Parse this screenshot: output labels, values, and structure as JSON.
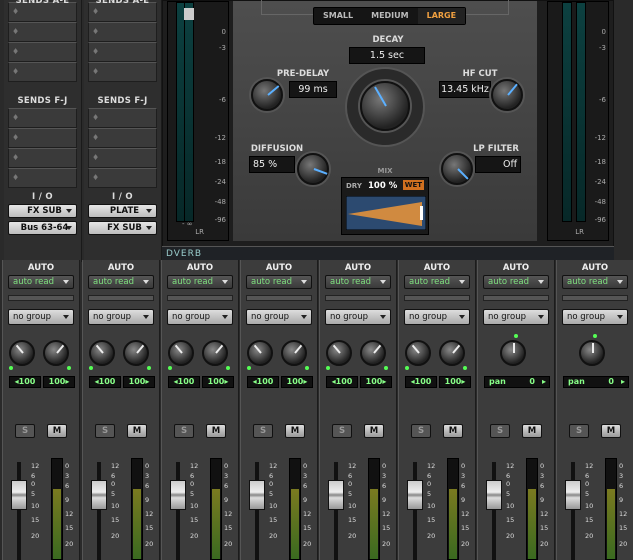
{
  "left_columns": [
    {
      "sends_ae": "SENDS A-E",
      "sends_fj": "SENDS F-J",
      "io": "I / O",
      "in": "FX SUB",
      "out": "Bus 63-64"
    },
    {
      "sends_ae": "SENDS A-E",
      "sends_fj": "SENDS F-J",
      "io": "I / O",
      "in": "PLATE",
      "out": "FX SUB"
    }
  ],
  "plugin": {
    "name": "DVERB",
    "sizes": [
      "SMALL",
      "MEDIUM",
      "LARGE"
    ],
    "decay": {
      "label": "DECAY",
      "value": "1.5 sec"
    },
    "predelay": {
      "label": "PRE-DELAY",
      "value": "99 ms"
    },
    "hfcut": {
      "label": "HF CUT",
      "value": "13.45 kHz"
    },
    "diffusion": {
      "label": "DIFFUSION",
      "value": "85 %"
    },
    "lpfilter": {
      "label": "LP FILTER",
      "value": "Off"
    },
    "mix": {
      "label": "MIX",
      "dry": "DRY",
      "value": "100 %",
      "wet": "WET"
    },
    "meter_scale": [
      "0",
      "-3",
      "-6",
      "-12",
      "-18",
      "-24",
      "-48",
      "-96"
    ],
    "meter_lr": "LR",
    "meter_inf": "- ∞"
  },
  "strips": [
    {
      "auto": "AUTO",
      "mode": "auto read",
      "group": "no group",
      "pan": [
        "100",
        "100"
      ],
      "stereo": true
    },
    {
      "auto": "AUTO",
      "mode": "auto read",
      "group": "no group",
      "pan": [
        "100",
        "100"
      ],
      "stereo": true
    },
    {
      "auto": "AUTO",
      "mode": "auto read",
      "group": "no group",
      "pan": [
        "100",
        "100"
      ],
      "stereo": true
    },
    {
      "auto": "AUTO",
      "mode": "auto read",
      "group": "no group",
      "pan": [
        "100",
        "100"
      ],
      "stereo": true
    },
    {
      "auto": "AUTO",
      "mode": "auto read",
      "group": "no group",
      "pan": [
        "100",
        "100"
      ],
      "stereo": true
    },
    {
      "auto": "AUTO",
      "mode": "auto read",
      "group": "no group",
      "pan": [
        "100",
        "100"
      ],
      "stereo": true
    },
    {
      "auto": "AUTO",
      "mode": "auto read",
      "group": "no group",
      "pan": [
        "pan",
        "0"
      ],
      "stereo": false
    },
    {
      "auto": "AUTO",
      "mode": "auto read",
      "group": "no group",
      "pan": [
        "pan",
        "0"
      ],
      "stereo": false
    }
  ],
  "solo": "S",
  "mute": "M",
  "fader_scale": [
    "12",
    "6",
    "0",
    "5",
    "10",
    "15",
    "20"
  ],
  "meter_scale": [
    "0",
    "3",
    "6",
    "9",
    "12",
    "15",
    "20"
  ]
}
